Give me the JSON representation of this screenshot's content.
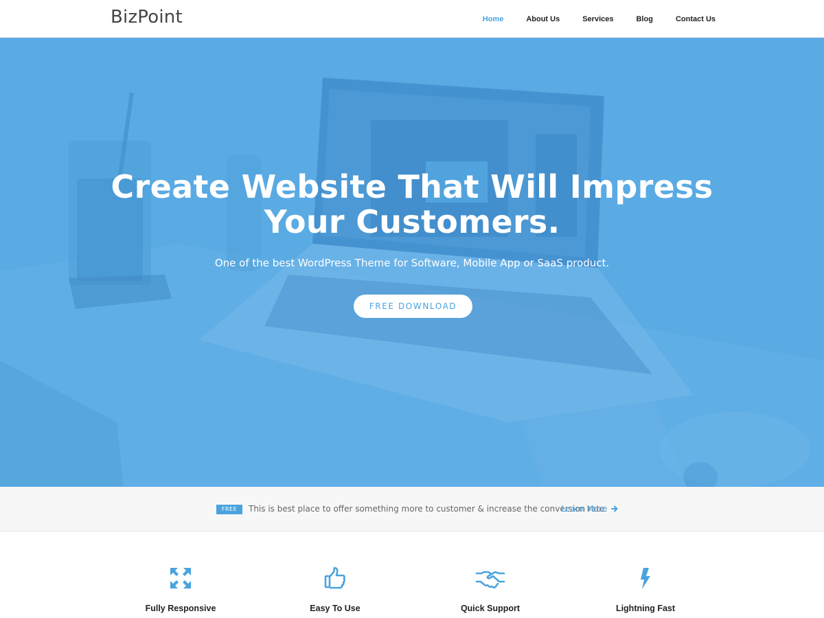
{
  "header": {
    "logo": "BizPoint",
    "nav": [
      {
        "label": "Home",
        "active": true
      },
      {
        "label": "About Us",
        "active": false
      },
      {
        "label": "Services",
        "active": false
      },
      {
        "label": "Blog",
        "active": false
      },
      {
        "label": "Contact Us",
        "active": false
      }
    ]
  },
  "hero": {
    "title_line1": "Create Website That Will Impress",
    "title_line2": "Your Customers.",
    "subtitle": "One of the best WordPress Theme for Software, Mobile App or SaaS product.",
    "button_label": "FREE DOWNLOAD",
    "overlay_color": "#5aaae3"
  },
  "offer": {
    "badge": "FREE",
    "text": "This is best place to offer something more to customer & increase the conversion rate.",
    "link_label": "Learn More",
    "link_icon": "arrow-right-icon"
  },
  "features": [
    {
      "label": "Fully Responsive",
      "icon": "expand-arrows-icon"
    },
    {
      "label": "Easy To Use",
      "icon": "thumbs-up-icon"
    },
    {
      "label": "Quick Support",
      "icon": "handshake-icon"
    },
    {
      "label": "Lightning Fast",
      "icon": "lightning-bolt-icon"
    }
  ],
  "colors": {
    "accent": "#4aa3df",
    "text_dark": "#222222",
    "offer_bg": "#f7f7f7"
  }
}
